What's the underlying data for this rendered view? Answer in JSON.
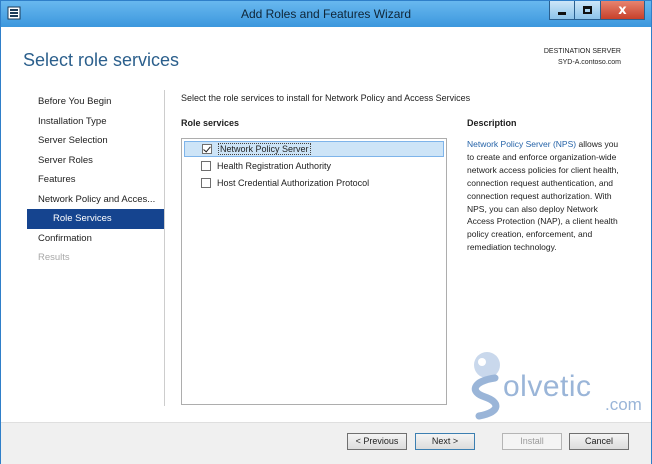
{
  "window": {
    "title": "Add Roles and Features Wizard",
    "controls": {
      "minimize_icon": "minimize-icon",
      "maximize_icon": "maximize-icon",
      "close_icon": "close-icon"
    }
  },
  "header": {
    "page_title": "Select role services",
    "destination_label": "DESTINATION SERVER",
    "destination_server": "SYD-A.contoso.com"
  },
  "nav": {
    "items": [
      {
        "label": "Before You Begin",
        "state": "normal"
      },
      {
        "label": "Installation Type",
        "state": "normal"
      },
      {
        "label": "Server Selection",
        "state": "normal"
      },
      {
        "label": "Server Roles",
        "state": "normal"
      },
      {
        "label": "Features",
        "state": "normal"
      },
      {
        "label": "Network Policy and Acces...",
        "state": "normal"
      },
      {
        "label": "Role Services",
        "state": "active"
      },
      {
        "label": "Confirmation",
        "state": "normal"
      },
      {
        "label": "Results",
        "state": "disabled"
      }
    ]
  },
  "main": {
    "instruction": "Select the role services to install for Network Policy and Access Services",
    "role_services_heading": "Role services",
    "roles": [
      {
        "label": "Network Policy Server",
        "checked": true,
        "selected": true
      },
      {
        "label": "Health Registration Authority",
        "checked": false,
        "selected": false
      },
      {
        "label": "Host Credential Authorization Protocol",
        "checked": false,
        "selected": false
      }
    ]
  },
  "description": {
    "heading": "Description",
    "link_text": "Network Policy Server (NPS)",
    "body": " allows you to create and enforce organization-wide network access policies for client health, connection request authentication, and connection request authorization. With NPS, you can also deploy Network Access Protection (NAP), a client health policy creation, enforcement, and remediation technology."
  },
  "watermark": {
    "text": "olvetic",
    "suffix": ".com"
  },
  "footer": {
    "previous": "< Previous",
    "next": "Next >",
    "install": "Install",
    "cancel": "Cancel"
  },
  "colors": {
    "titlebar": "#3c97dd",
    "accent": "#15448f",
    "title_text": "#2b5f8c",
    "link": "#2563a8"
  }
}
